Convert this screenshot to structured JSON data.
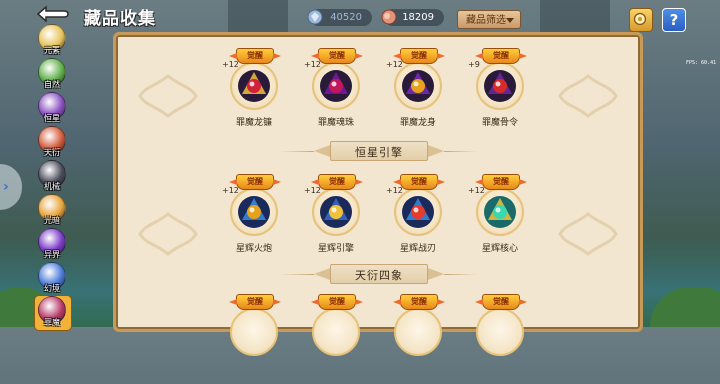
{
  "header": {
    "title": "藏品收集",
    "back_icon": "back-arrow-icon"
  },
  "resources": [
    {
      "name": "diamond",
      "icon": "diamond-icon",
      "value": "40520",
      "color": "#7fa0c8"
    },
    {
      "name": "meat",
      "icon": "meat-icon",
      "value": "18209",
      "color": "#d87a5a"
    }
  ],
  "filter": {
    "label": "藏品筛选"
  },
  "fps": "FPS: 60.41",
  "help_label": "?",
  "sidebar": {
    "items": [
      {
        "label": "元素",
        "color": "#e7c35a"
      },
      {
        "label": "自然",
        "color": "#5fb04a"
      },
      {
        "label": "恒星",
        "color": "#8a4fc0"
      },
      {
        "label": "天衍",
        "color": "#d25a3a"
      },
      {
        "label": "机械",
        "color": "#4a4a5a"
      },
      {
        "label": "光暗",
        "color": "#e8a33a"
      },
      {
        "label": "异界",
        "color": "#7a3ac8"
      },
      {
        "label": "幻境",
        "color": "#4a7ad8"
      },
      {
        "label": "罪魔",
        "color": "#b83a6a"
      }
    ],
    "expand_icon": "chevron-right-icon"
  },
  "badge_label": "觉醒",
  "sections": [
    {
      "items": [
        {
          "name": "罪魔龙镰",
          "level": "+12",
          "palette": [
            "#2a1a3a",
            "#d1203a",
            "#f0c23a"
          ]
        },
        {
          "name": "罪魔魂珠",
          "level": "+12",
          "palette": [
            "#2a1a3a",
            "#c0185a",
            "#7a1aa0"
          ]
        },
        {
          "name": "罪魔龙身",
          "level": "+12",
          "palette": [
            "#2a1a3a",
            "#e8a21a",
            "#7a2ac0"
          ]
        },
        {
          "name": "罪魔骨令",
          "level": "+9",
          "palette": [
            "#2a1a3a",
            "#d82a2a",
            "#6a2aa0"
          ]
        }
      ]
    },
    {
      "title": "恒星引擎",
      "items": [
        {
          "name": "星辉火炮",
          "level": "+12",
          "palette": [
            "#1a2a5a",
            "#e8a21a",
            "#3a8ae0"
          ]
        },
        {
          "name": "星辉引擎",
          "level": "+12",
          "palette": [
            "#1a2a5a",
            "#f0c23a",
            "#3a6ad0"
          ]
        },
        {
          "name": "星辉战刃",
          "level": "+12",
          "palette": [
            "#1a2a5a",
            "#e83a2a",
            "#3a8ae0"
          ]
        },
        {
          "name": "星辉核心",
          "level": "+12",
          "palette": [
            "#1a6a6a",
            "#3ad8b0",
            "#f0c23a"
          ]
        }
      ]
    },
    {
      "title": "天衍四象",
      "items": [
        {
          "name": "",
          "level": ""
        },
        {
          "name": "",
          "level": ""
        },
        {
          "name": "",
          "level": ""
        },
        {
          "name": "",
          "level": ""
        }
      ]
    }
  ]
}
